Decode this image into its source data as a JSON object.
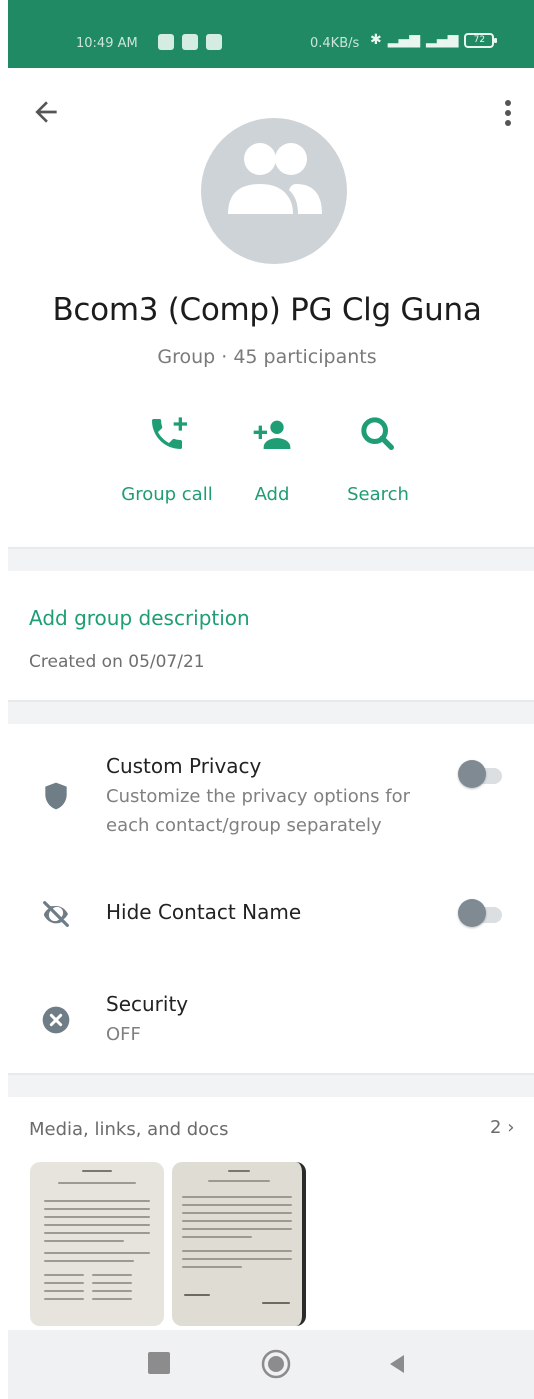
{
  "status_bar": {
    "time": "10:49 AM",
    "network_speed": "0.4KB/s",
    "battery": "72"
  },
  "header": {
    "back_icon": "arrow-left-icon",
    "menu_icon": "more-vertical-icon",
    "avatar_icon": "group-avatar-icon",
    "group_name": "Bcom3 (Comp) PG Clg Guna",
    "group_subtitle": "Group · 45 participants"
  },
  "actions": [
    {
      "label": "Group call",
      "icon": "phone-add-icon"
    },
    {
      "label": "Add",
      "icon": "add-person-icon"
    },
    {
      "label": "Search",
      "icon": "search-icon"
    }
  ],
  "description": {
    "add_label": "Add group description",
    "created": "Created on 05/07/21"
  },
  "settings": {
    "custom_privacy": {
      "title": "Custom Privacy",
      "subtitle_line1": "Customize the privacy options for",
      "subtitle_line2": "each contact/group separately",
      "icon": "shield-icon",
      "enabled": false
    },
    "hide_contact_name": {
      "title": "Hide Contact Name",
      "icon": "eye-off-icon",
      "enabled": false
    },
    "security": {
      "title": "Security",
      "value": "OFF",
      "icon": "close-circle-icon"
    }
  },
  "media": {
    "label": "Media, links, and docs",
    "count": "2",
    "chevron": "chevron-right-icon"
  },
  "colors": {
    "accent": "#1f9d74",
    "status_bar": "#1f8a63",
    "avatar_bg": "#cdd3d7",
    "icon_gray": "#6f7d87"
  }
}
